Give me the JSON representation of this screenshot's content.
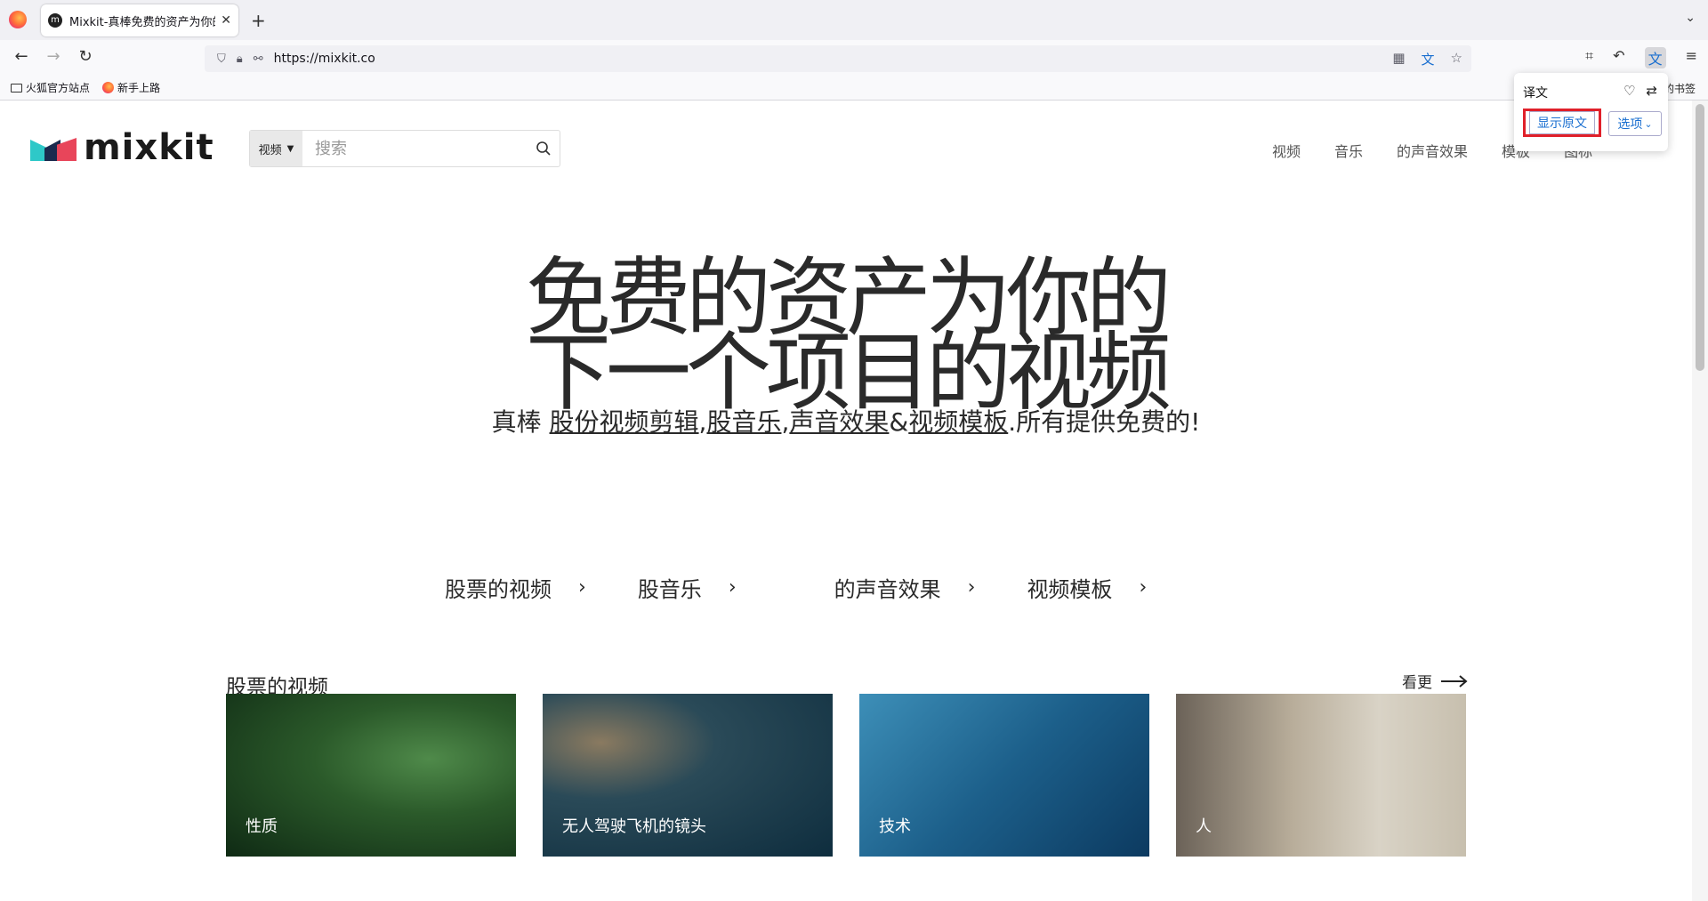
{
  "browser": {
    "tab_title": "Mixkit-真棒免费的资产为你的下一个",
    "tab_favicon": "m",
    "url": "https://mixkit.co",
    "bookmarks": [
      {
        "label": "火狐官方站点",
        "icon": "folder-icon"
      },
      {
        "label": "新手上路",
        "icon": "firefox-icon"
      }
    ],
    "bookmarks_right": "的书签"
  },
  "translate_popup": {
    "title": "译文",
    "show_original": "显示原文",
    "options": "选项"
  },
  "site": {
    "logo_text": "mixkit",
    "search_type": "视频",
    "search_placeholder": "搜索",
    "nav": [
      "视频",
      "音乐",
      "的声音效果",
      "模板",
      "图标"
    ]
  },
  "hero": {
    "title_line1": "免费的资产为你的",
    "title_line2": "下一个项目的视频",
    "sub_prefix": "真棒",
    "sub_link1": "股份视频剪辑",
    "sub_sep1": ",",
    "sub_link2": "股音乐",
    "sub_sep2": ",",
    "sub_link3": "声音效果",
    "sub_amp": "&",
    "sub_link4": "视频模板",
    "sub_suffix": ".所有提供免费的!"
  },
  "categories": [
    "股票的视频",
    "股音乐",
    "的声音效果",
    "视频模板"
  ],
  "section": {
    "title": "股票的视频",
    "see_more": "看更",
    "cards": [
      "性质",
      "无人驾驶飞机的镜头",
      "技术",
      "人"
    ]
  }
}
